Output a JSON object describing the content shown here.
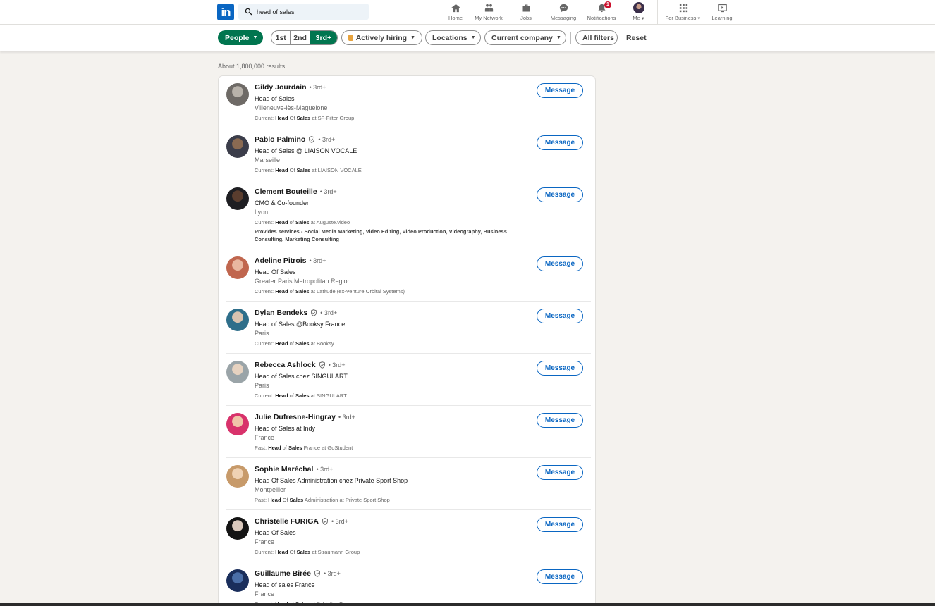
{
  "search": {
    "value": "head of sales"
  },
  "nav": {
    "home": "Home",
    "network": "My Network",
    "jobs": "Jobs",
    "messaging": "Messaging",
    "notifications": "Notifications",
    "notifications_badge": "1",
    "me": "Me",
    "business": "For Business",
    "learning": "Learning"
  },
  "filters": {
    "people": "People",
    "first": "1st",
    "second": "2nd",
    "third": "3rd+",
    "hiring": "Actively hiring",
    "locations": "Locations",
    "company": "Current company",
    "all": "All filters",
    "reset": "Reset"
  },
  "results_count": "About 1,800,000 results",
  "message_label": "Message",
  "results": [
    {
      "name": "Gildy Jourdain",
      "verified": false,
      "degree": "• 3rd+",
      "headline": "Head of Sales",
      "location": "Villeneuve-lès-Maguelone",
      "snip_pre": "Current: ",
      "snip_b1": "Head",
      "snip_mid": " Of ",
      "snip_b2": "Sales",
      "snip_post": " at SF-Filter Group"
    },
    {
      "name": "Pablo Palmino",
      "verified": true,
      "degree": "• 3rd+",
      "headline": "Head of Sales @ LIAISON VOCALE",
      "location": "Marseille",
      "snip_pre": "Current: ",
      "snip_b1": "Head",
      "snip_mid": " Of ",
      "snip_b2": "Sales",
      "snip_post": " at LIAISON VOCALE"
    },
    {
      "name": "Clement Bouteille",
      "verified": false,
      "degree": "• 3rd+",
      "headline": "CMO & Co-founder",
      "location": "Lyon",
      "snip_pre": "Current: ",
      "snip_b1": "Head",
      "snip_mid": " of ",
      "snip_b2": "Sales",
      "snip_post": " at Auguste.video",
      "services": "Provides services - Social Media Marketing, Video Editing, Video Production, Videography, Business Consulting, Marketing Consulting"
    },
    {
      "name": "Adeline Pitrois",
      "verified": false,
      "degree": "• 3rd+",
      "headline": "Head Of Sales",
      "location": "Greater Paris Metropolitan Region",
      "snip_pre": "Current: ",
      "snip_b1": "Head",
      "snip_mid": " of ",
      "snip_b2": "Sales",
      "snip_post": " at Latitude (ex-Venture Orbital Systems)"
    },
    {
      "name": "Dylan Bendeks",
      "verified": true,
      "degree": "• 3rd+",
      "headline": "Head of Sales @Booksy France",
      "location": "Paris",
      "snip_pre": "Current: ",
      "snip_b1": "Head",
      "snip_mid": " of ",
      "snip_b2": "Sales",
      "snip_post": " at Booksy"
    },
    {
      "name": "Rebecca Ashlock",
      "verified": true,
      "degree": "• 3rd+",
      "headline": "Head of Sales chez SINGULART",
      "location": "Paris",
      "snip_pre": "Current: ",
      "snip_b1": "Head",
      "snip_mid": " of ",
      "snip_b2": "Sales",
      "snip_post": " at SINGULART"
    },
    {
      "name": "Julie Dufresne-Hingray",
      "verified": false,
      "degree": "• 3rd+",
      "headline": "Head of Sales at Indy",
      "location": "France",
      "snip_pre": "Past: ",
      "snip_b1": "Head",
      "snip_mid": " of ",
      "snip_b2": "Sales",
      "snip_post": " France at GoStudent"
    },
    {
      "name": "Sophie Maréchal",
      "verified": false,
      "degree": "• 3rd+",
      "headline": "Head Of Sales Administration chez Private Sport Shop",
      "location": "Montpellier",
      "snip_pre": "Past: ",
      "snip_b1": "Head",
      "snip_mid": " Of ",
      "snip_b2": "Sales",
      "snip_post": " Administration at Private Sport Shop"
    },
    {
      "name": "Christelle FURIGA",
      "verified": true,
      "degree": "• 3rd+",
      "headline": "Head Of Sales",
      "location": "France",
      "snip_pre": "Current: ",
      "snip_b1": "Head",
      "snip_mid": " Of ",
      "snip_b2": "Sales",
      "snip_post": " at Straumann Group"
    },
    {
      "name": "Guillaume Birée",
      "verified": true,
      "degree": "• 3rd+",
      "headline": "Head of sales France",
      "location": "France",
      "snip_pre": "Current: ",
      "snip_b1": "Head",
      "snip_mid": " of ",
      "snip_b2": "Sales",
      "snip_post": " at Schlotter Group"
    }
  ],
  "colors": {
    "brand": "#0a66c2",
    "green": "#01754f",
    "badge": "#cb112d"
  }
}
